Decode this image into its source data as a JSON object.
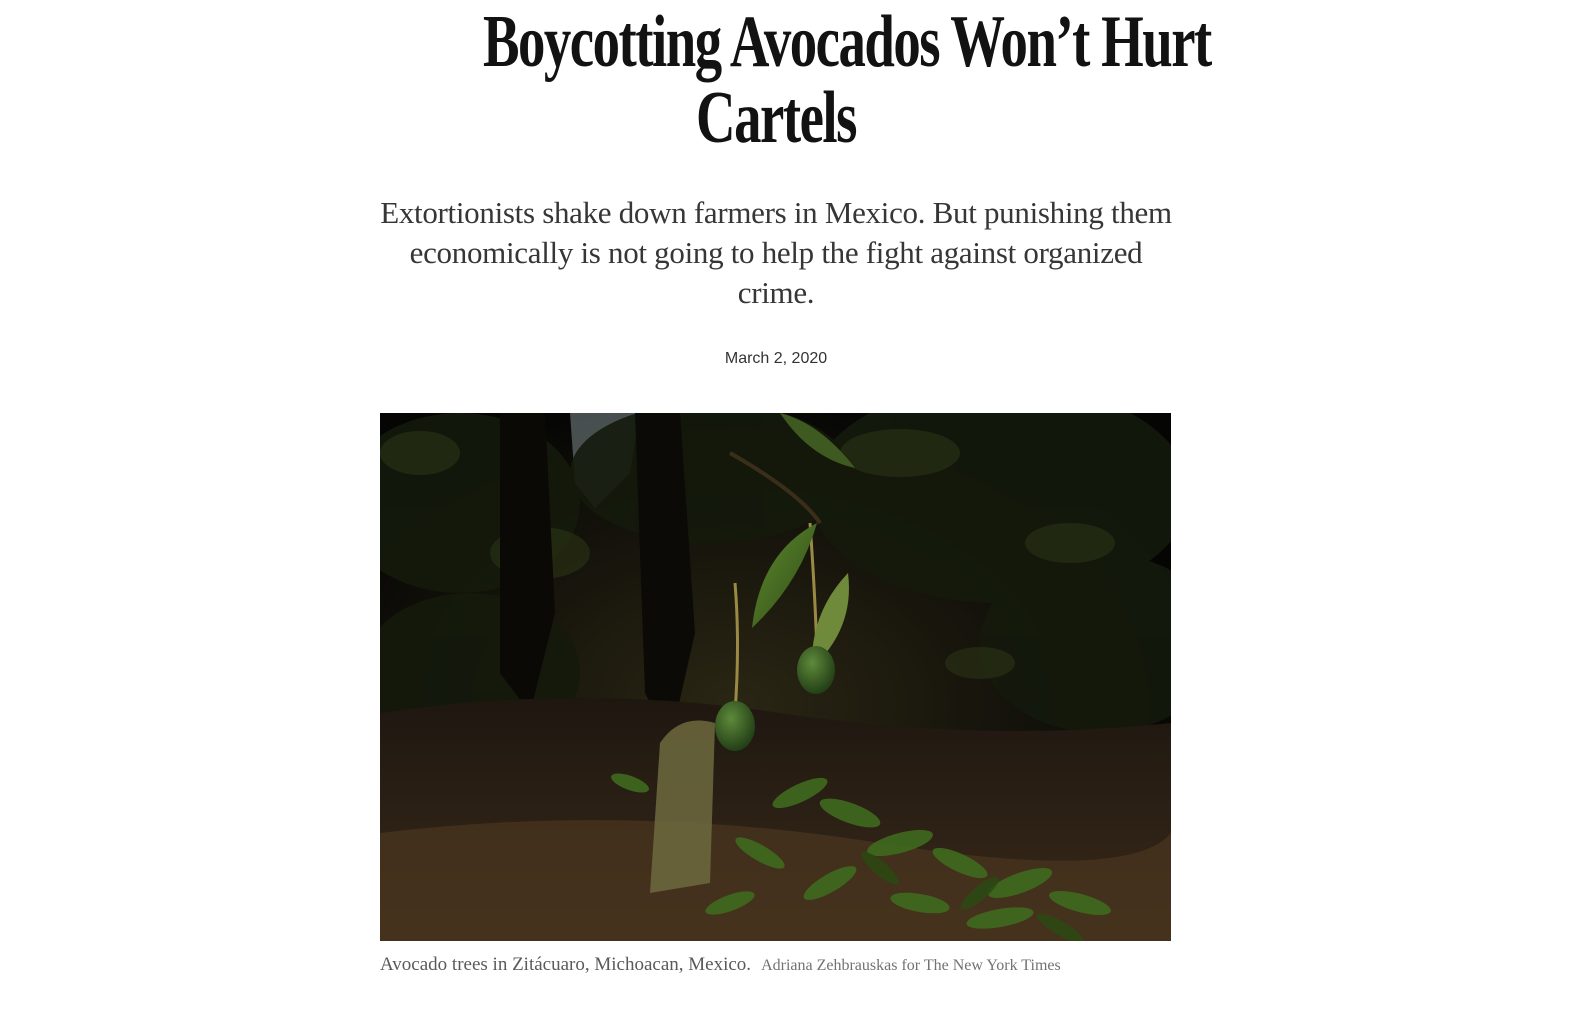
{
  "article": {
    "headline_line1": "Boycotting Avocados Won’t Hurt",
    "headline_line2": "Cartels",
    "summary": "Extortionists shake down farmers in Mexico. But punishing them economically is not going to help the fight against organized crime.",
    "date": "March 2, 2020"
  },
  "image": {
    "caption": "Avocado trees in Zitácuaro, Michoacan, Mexico.",
    "credit": "Adriana Zehbrauskas for The New York Times"
  }
}
